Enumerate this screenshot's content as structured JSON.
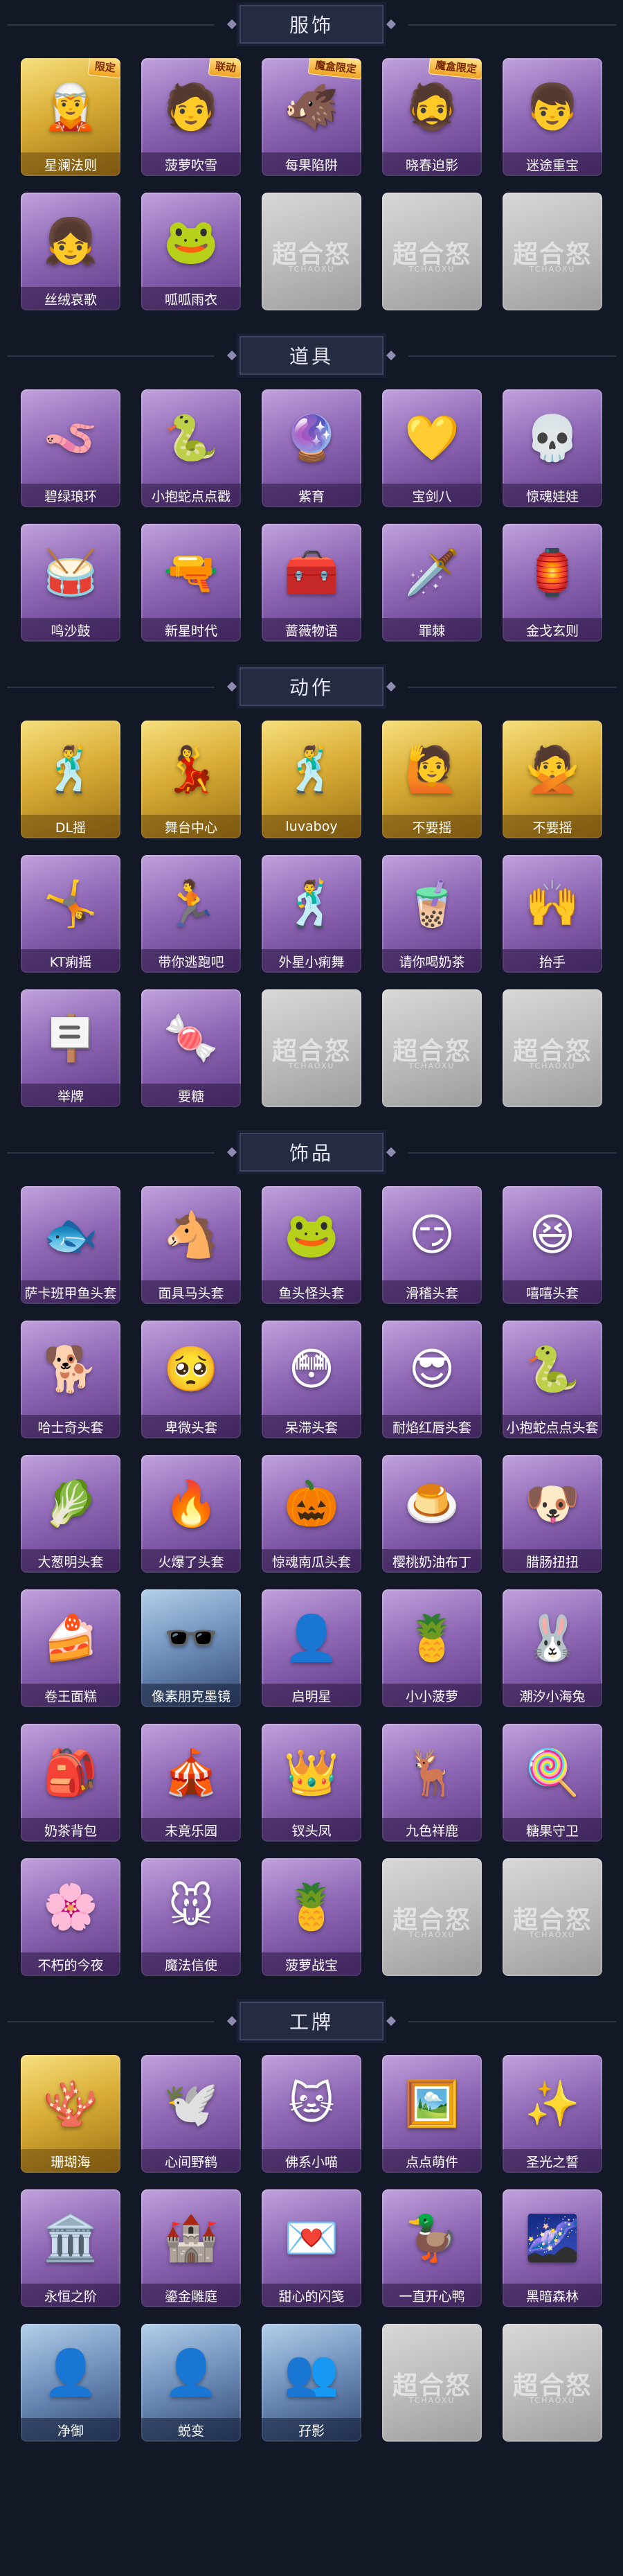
{
  "colors": {
    "background": "#121826",
    "purple_card": "#8f68b6",
    "gold_card": "#d9ad35",
    "blue_card": "#6c8cb8",
    "empty_card": "#bcbcbc"
  },
  "sections": [
    {
      "title": "服饰",
      "items": [
        {
          "label": "星澜法则",
          "tier": "gold",
          "icon": "🧝",
          "tag": "限定"
        },
        {
          "label": "菠萝吹雪",
          "tier": "purple",
          "icon": "🧑",
          "tag": "联动"
        },
        {
          "label": "每果陷阱",
          "tier": "purple",
          "icon": "🐗",
          "tag": "魔盒限定"
        },
        {
          "label": "晓春迫影",
          "tier": "purple",
          "icon": "🧔",
          "tag": "魔盒限定"
        },
        {
          "label": "迷途重宝",
          "tier": "purple",
          "icon": "👦"
        },
        {
          "label": "丝绒哀歌",
          "tier": "purple",
          "icon": "👧"
        },
        {
          "label": "呱呱雨衣",
          "tier": "purple",
          "icon": "🐸"
        },
        {
          "label": "",
          "tier": "empty",
          "icon": ""
        },
        {
          "label": "",
          "tier": "empty",
          "icon": ""
        },
        {
          "label": "",
          "tier": "empty",
          "icon": ""
        }
      ]
    },
    {
      "title": "道具",
      "items": [
        {
          "label": "碧绿琅环",
          "tier": "purple",
          "icon": "🪱"
        },
        {
          "label": "小抱蛇点点戳",
          "tier": "purple",
          "icon": "🐍"
        },
        {
          "label": "紫育",
          "tier": "purple",
          "icon": "🔮"
        },
        {
          "label": "宝剑八",
          "tier": "purple",
          "icon": "💛"
        },
        {
          "label": "惊魂娃娃",
          "tier": "purple",
          "icon": "💀"
        },
        {
          "label": "鸣沙鼓",
          "tier": "purple",
          "icon": "🥁"
        },
        {
          "label": "新星时代",
          "tier": "purple",
          "icon": "🔫"
        },
        {
          "label": "蔷薇物语",
          "tier": "purple",
          "icon": "🧰"
        },
        {
          "label": "罪棘",
          "tier": "purple",
          "icon": "🗡️"
        },
        {
          "label": "金戈玄则",
          "tier": "purple",
          "icon": "🏮"
        }
      ]
    },
    {
      "title": "动作",
      "items": [
        {
          "label": "DL摇",
          "tier": "gold",
          "icon": "🕺"
        },
        {
          "label": "舞台中心",
          "tier": "gold",
          "icon": "💃"
        },
        {
          "label": "luvaboy",
          "tier": "gold",
          "icon": "🕺"
        },
        {
          "label": "不要摇",
          "tier": "gold",
          "icon": "🙋"
        },
        {
          "label": "不要摇",
          "tier": "gold",
          "icon": "🙅"
        },
        {
          "label": "KT痢摇",
          "tier": "purple",
          "icon": "🤸"
        },
        {
          "label": "带你逃跑吧",
          "tier": "purple",
          "icon": "🏃"
        },
        {
          "label": "外星小痢舞",
          "tier": "purple",
          "icon": "🕺"
        },
        {
          "label": "请你喝奶茶",
          "tier": "purple",
          "icon": "🧋"
        },
        {
          "label": "抬手",
          "tier": "purple",
          "icon": "🙌"
        },
        {
          "label": "举牌",
          "tier": "purple",
          "icon": "🪧"
        },
        {
          "label": "要糖",
          "tier": "purple",
          "icon": "🍬"
        },
        {
          "label": "",
          "tier": "empty",
          "icon": ""
        },
        {
          "label": "",
          "tier": "empty",
          "icon": ""
        },
        {
          "label": "",
          "tier": "empty",
          "icon": ""
        }
      ]
    },
    {
      "title": "饰品",
      "items": [
        {
          "label": "萨卡班甲鱼头套",
          "tier": "purple",
          "icon": "🐟"
        },
        {
          "label": "面具马头套",
          "tier": "purple",
          "icon": "🐴"
        },
        {
          "label": "鱼头怪头套",
          "tier": "purple",
          "icon": "🐸"
        },
        {
          "label": "滑稽头套",
          "tier": "purple",
          "icon": "😏"
        },
        {
          "label": "嘻嘻头套",
          "tier": "purple",
          "icon": "😆"
        },
        {
          "label": "哈士奇头套",
          "tier": "purple",
          "icon": "🐕"
        },
        {
          "label": "卑微头套",
          "tier": "purple",
          "icon": "🥺"
        },
        {
          "label": "呆滞头套",
          "tier": "purple",
          "icon": "😳"
        },
        {
          "label": "耐焰红唇头套",
          "tier": "purple",
          "icon": "😎"
        },
        {
          "label": "小抱蛇点点头套",
          "tier": "purple",
          "icon": "🐍"
        },
        {
          "label": "大葱明头套",
          "tier": "purple",
          "icon": "🥬"
        },
        {
          "label": "火爆了头套",
          "tier": "purple",
          "icon": "🔥"
        },
        {
          "label": "惊魂南瓜头套",
          "tier": "purple",
          "icon": "🎃"
        },
        {
          "label": "樱桃奶油布丁",
          "tier": "purple",
          "icon": "🍮"
        },
        {
          "label": "腊肠扭扭",
          "tier": "purple",
          "icon": "🐶"
        },
        {
          "label": "卷王面糕",
          "tier": "purple",
          "icon": "🍰"
        },
        {
          "label": "像素朋克墨镜",
          "tier": "blue",
          "icon": "🕶️"
        },
        {
          "label": "启明星",
          "tier": "purple",
          "icon": "👤"
        },
        {
          "label": "小小菠萝",
          "tier": "purple",
          "icon": "🍍"
        },
        {
          "label": "潮汐小海兔",
          "tier": "purple",
          "icon": "🐰"
        },
        {
          "label": "奶茶背包",
          "tier": "purple",
          "icon": "🎒"
        },
        {
          "label": "未竟乐园",
          "tier": "purple",
          "icon": "🎪"
        },
        {
          "label": "钗头凤",
          "tier": "purple",
          "icon": "👑"
        },
        {
          "label": "九色祥鹿",
          "tier": "purple",
          "icon": "🦌"
        },
        {
          "label": "糖果守卫",
          "tier": "purple",
          "icon": "🍭"
        },
        {
          "label": "不朽的今夜",
          "tier": "purple",
          "icon": "🌸"
        },
        {
          "label": "魔法信使",
          "tier": "purple",
          "icon": "🐭"
        },
        {
          "label": "菠萝战宝",
          "tier": "purple",
          "icon": "🍍"
        },
        {
          "label": "",
          "tier": "empty",
          "icon": ""
        },
        {
          "label": "",
          "tier": "empty",
          "icon": ""
        }
      ]
    },
    {
      "title": "工牌",
      "items": [
        {
          "label": "珊瑚海",
          "tier": "gold",
          "icon": "🪸"
        },
        {
          "label": "心间野鹤",
          "tier": "purple",
          "icon": "🕊️"
        },
        {
          "label": "佛系小喵",
          "tier": "purple",
          "icon": "🐱"
        },
        {
          "label": "点点萌件",
          "tier": "purple",
          "icon": "🖼️"
        },
        {
          "label": "圣光之誓",
          "tier": "purple",
          "icon": "✨"
        },
        {
          "label": "永恒之阶",
          "tier": "purple",
          "icon": "🏛️"
        },
        {
          "label": "鎏金雕庭",
          "tier": "purple",
          "icon": "🏰"
        },
        {
          "label": "甜心的闪笺",
          "tier": "purple",
          "icon": "💌"
        },
        {
          "label": "一直开心鸭",
          "tier": "purple",
          "icon": "🦆"
        },
        {
          "label": "黑暗森林",
          "tier": "purple",
          "icon": "🌌"
        },
        {
          "label": "净御",
          "tier": "blue",
          "icon": "👤"
        },
        {
          "label": "蜕变",
          "tier": "blue",
          "icon": "👤"
        },
        {
          "label": "孖影",
          "tier": "blue",
          "icon": "👥"
        },
        {
          "label": "",
          "tier": "empty",
          "icon": ""
        },
        {
          "label": "",
          "tier": "empty",
          "icon": ""
        }
      ]
    }
  ],
  "empty_watermark": {
    "main": "超合怒",
    "sub": "TCHAOXU"
  }
}
